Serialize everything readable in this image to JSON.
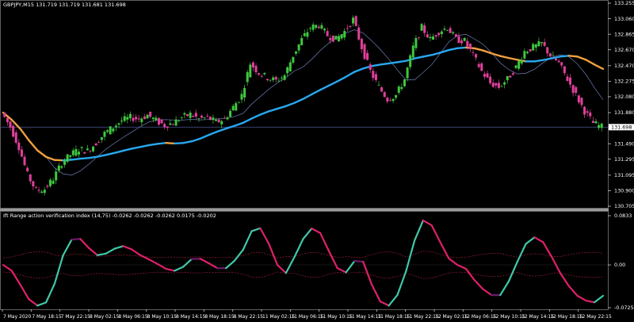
{
  "header": {
    "symbol_line": "GBPJPY,M15  131.719 131.719 131.681 131.698",
    "indicator_line": "Ift Range action verification index (14,75) -0.0262 -0.0262 -0.0262 0.0175 -0.0202"
  },
  "price_axis": {
    "ticks": [
      "133.255",
      "133.060",
      "132.865",
      "132.670",
      "132.470",
      "132.275",
      "132.080",
      "131.880",
      "131.685",
      "131.490",
      "131.295",
      "131.095",
      "130.900",
      "130.705"
    ],
    "current_price_label": "131.698"
  },
  "indicator_axis": {
    "ticks": [
      "0.0833",
      "0.00",
      "-0.0725"
    ]
  },
  "time_axis": {
    "labels": [
      "7 May 2020",
      "7 May 18:15",
      "7 May 22:15",
      "8 May 02:15",
      "8 May 06:15",
      "8 May 10:15",
      "8 May 14:15",
      "8 May 18:15",
      "8 May 22:15",
      "11 May 02:15",
      "11 May 06:15",
      "11 May 10:15",
      "11 May 14:15",
      "11 May 18:15",
      "11 May 22:15",
      "12 May 02:15",
      "12 May 06:15",
      "12 May 10:15",
      "12 May 14:15",
      "12 May 18:15",
      "12 May 22:15"
    ]
  },
  "colors": {
    "background": "#000000",
    "grid": "#1e2a44",
    "bull_candle": "#3ec83e",
    "bear_candle": "#e0409a",
    "neutral_candle": "#9a9a9a",
    "ma_slow_a": "#f0a040",
    "ma_slow_b": "#28a8f0",
    "ma_thin": "#6070a0",
    "indicator_up": "#40c8a8",
    "indicator_dn": "#e0206a",
    "indicator_flat": "#6a1a6a",
    "band": "#b02040",
    "axis_text": "#ffffff"
  },
  "chart_data": {
    "type": "candlestick-with-indicator",
    "symbol": "GBPJPY",
    "timeframe": "M15",
    "ohlc_last": {
      "open": 131.719,
      "high": 131.719,
      "low": 131.681,
      "close": 131.698
    },
    "price_ylim": [
      130.705,
      133.255
    ],
    "indicator_ylim": [
      -0.0725,
      0.0833
    ],
    "indicator_params": "(14,75)",
    "indicator_values": [
      -0.0262,
      -0.0262,
      -0.0262,
      0.0175,
      -0.0202
    ],
    "price_series": [
      131.88,
      131.7,
      131.45,
      131.1,
      130.9,
      130.92,
      131.05,
      131.25,
      131.35,
      131.42,
      131.4,
      131.5,
      131.62,
      131.7,
      131.78,
      131.82,
      131.8,
      131.85,
      131.78,
      131.72,
      131.75,
      131.82,
      131.86,
      131.8,
      131.82,
      131.76,
      131.8,
      131.95,
      132.1,
      132.5,
      132.38,
      132.32,
      132.28,
      132.35,
      132.6,
      132.8,
      132.95,
      132.98,
      132.85,
      132.8,
      132.9,
      133.05,
      132.7,
      132.4,
      132.2,
      132.05,
      132.1,
      132.3,
      132.7,
      132.95,
      132.8,
      132.9,
      132.95,
      132.8,
      132.78,
      132.6,
      132.4,
      132.25,
      132.2,
      132.3,
      132.45,
      132.65,
      132.7,
      132.75,
      132.6,
      132.5,
      132.3,
      132.1,
      131.9,
      131.75,
      131.7
    ]
  }
}
